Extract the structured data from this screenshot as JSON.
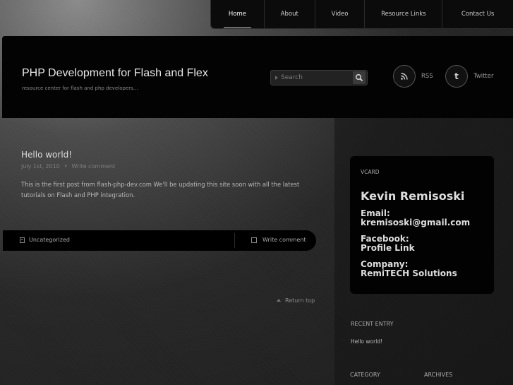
{
  "nav": {
    "items": [
      "Home",
      "About",
      "Video",
      "Resource Links",
      "Contact Us"
    ]
  },
  "header": {
    "title": "PHP Development for Flash and Flex",
    "description": "resource center for flash and php developers...",
    "search_placeholder": "Search",
    "rss_label": "RSS",
    "twitter_label": "Twitter",
    "rss_icon": "rss-icon",
    "twitter_icon": "twitter-icon"
  },
  "post": {
    "title": "Hello world!",
    "date": "July 1st, 2010",
    "comment_link": "Write comment",
    "body": "This is the first post from flash-php-dev.com  We'll be updating this site soon with all the latest tutorials on Flash and PHP integration.",
    "category": "Uncategorized",
    "write_comment": "Write comment"
  },
  "return_top": "Return top",
  "sidebar": {
    "vcard": {
      "label": "VCARD",
      "name": "Kevin Remisoski",
      "email_label": "Email:",
      "email": "kremisoski@gmail.com",
      "facebook_label": "Facebook:",
      "facebook": "Profile Link",
      "company_label": "Company:",
      "company": "RemiTECH Solutions"
    },
    "recent_heading": "RECENT ENTRY",
    "recent_entry": "Hello world!",
    "category_heading": "CATEGORY",
    "archives_heading": "ARCHIVES"
  }
}
